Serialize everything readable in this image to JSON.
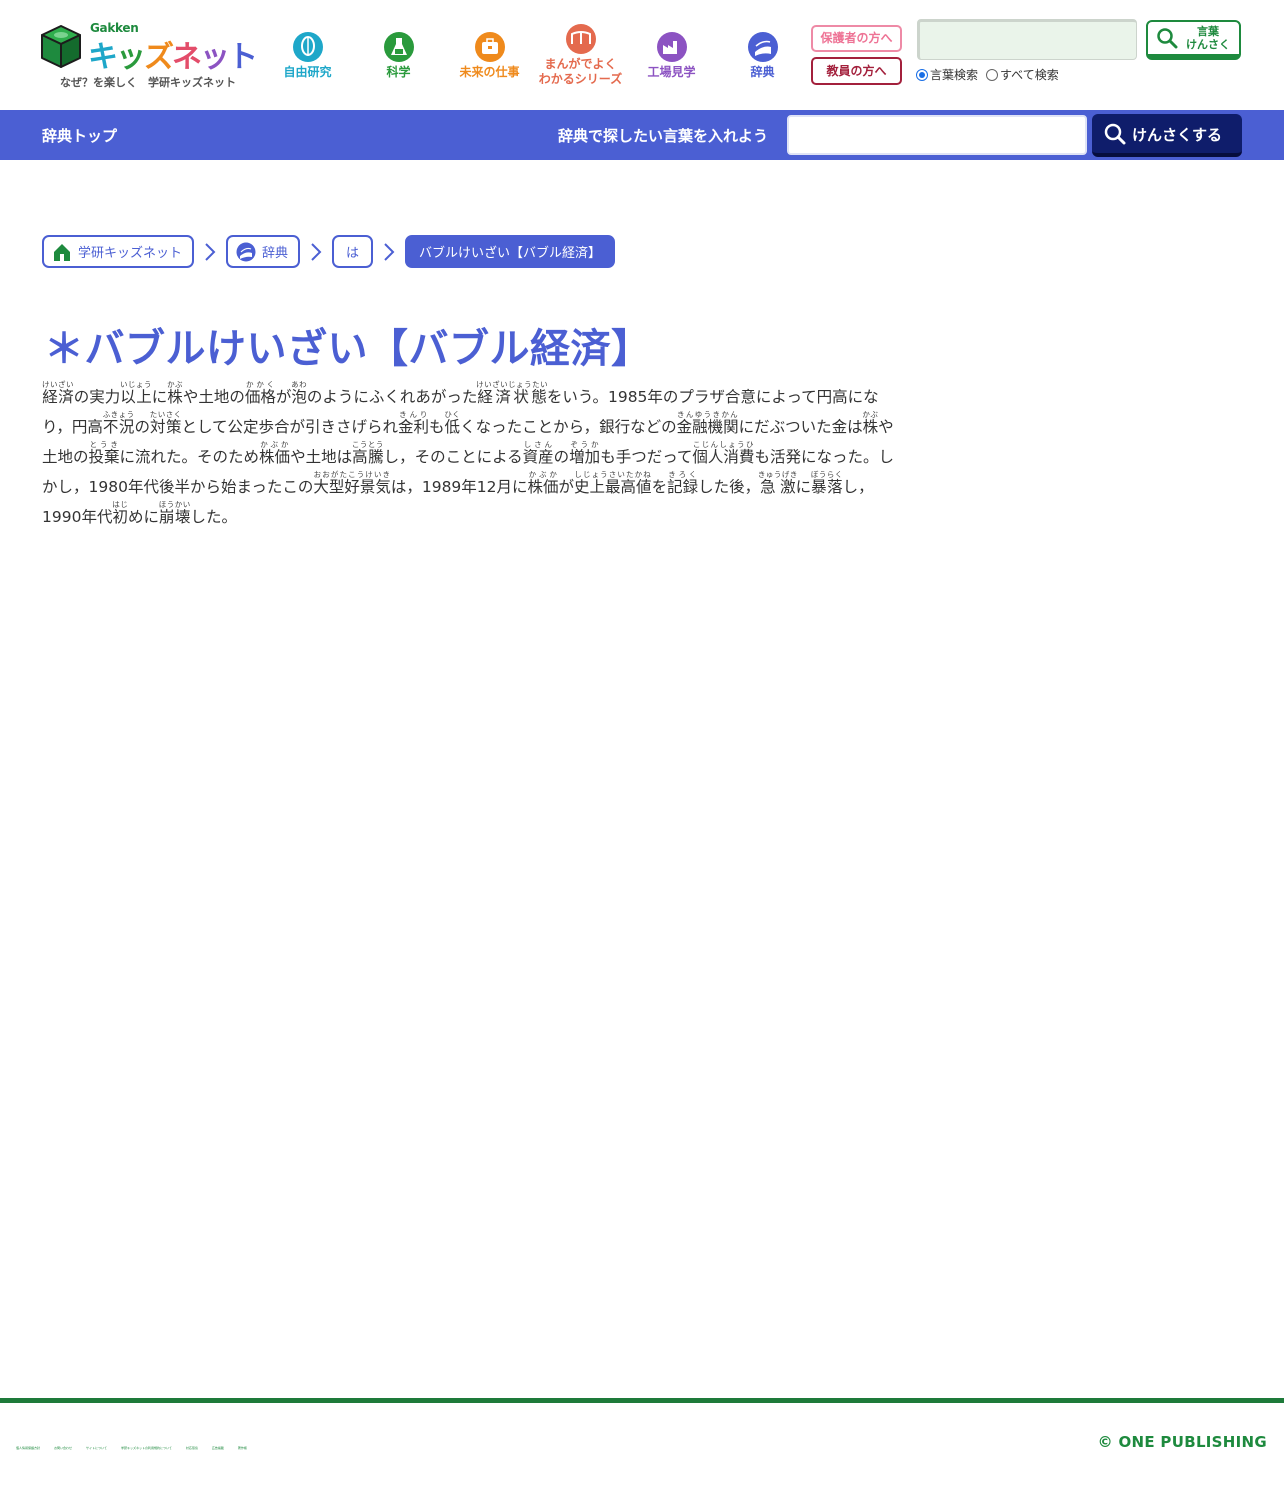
{
  "header": {
    "logo": {
      "brand": "Gakken",
      "name_parts": [
        "キ",
        "ッ",
        "ズ",
        "ネ",
        "ッ",
        "ト"
      ],
      "tagline": "なぜ？を楽しく　学研キッズネット"
    },
    "categories": [
      {
        "label": "自由研究",
        "color": "#1ea7c9",
        "icon": "lightbulb-icon"
      },
      {
        "label": "科学",
        "color": "#2a9a3c",
        "icon": "flask-icon"
      },
      {
        "label": "未来の仕事",
        "color": "#ef8a1c",
        "icon": "briefcase-icon"
      },
      {
        "label": "まんがでよく",
        "label2": "わかるシリーズ",
        "color": "#e46a4e",
        "icon": "manga-book-icon"
      },
      {
        "label": "工場見学",
        "color": "#8c53c2",
        "icon": "factory-icon"
      },
      {
        "label": "辞典",
        "color": "#4b5fd3",
        "icon": "dictionary-icon"
      }
    ],
    "parent_button": "保護者の方へ",
    "teacher_button": "教員の方へ",
    "search": {
      "placeholder": "",
      "button_line1": "言葉",
      "button_line2": "けんさく",
      "radio_word": "言葉検索",
      "radio_all": "すべて検索"
    },
    "colors": {
      "green": "#1e8a3e",
      "blue": "#4b5fd3"
    }
  },
  "dict_bar": {
    "top_link": "辞典トップ",
    "prompt": "辞典で探したい言葉を入れよう",
    "placeholder": "",
    "search_button": "けんさくする"
  },
  "breadcrumb": [
    {
      "label": "学研キッズネット",
      "icon": "home-icon"
    },
    {
      "label": "辞典",
      "icon": "dictionary-icon"
    },
    {
      "label": "は"
    },
    {
      "label": "バブルけいざい【バブル経済】"
    }
  ],
  "entry": {
    "title": "＊バブルけいざい【バブル経済】",
    "body": [
      {
        "r": "経済",
        "f": "けいざい"
      },
      {
        "t": "の実力"
      },
      {
        "r": "以上",
        "f": "いじょう"
      },
      {
        "t": "に"
      },
      {
        "r": "株",
        "f": "かぶ"
      },
      {
        "t": "や土地の"
      },
      {
        "r": "価格",
        "f": "かかく"
      },
      {
        "t": "が"
      },
      {
        "r": "泡",
        "f": "あわ"
      },
      {
        "t": "のようにふくれあがった"
      },
      {
        "r": "経済状態",
        "f": "けいざいじょうたい"
      },
      {
        "t": "をいう。1985年のプラザ合意によって円高になり，円高"
      },
      {
        "r": "不況",
        "f": "ふきょう"
      },
      {
        "t": "の"
      },
      {
        "r": "対策",
        "f": "たいさく"
      },
      {
        "t": "として公定歩合が引きさげられ"
      },
      {
        "r": "金利",
        "f": "きんり"
      },
      {
        "t": "も"
      },
      {
        "r": "低",
        "f": "ひく"
      },
      {
        "t": "くなったことから，銀行などの"
      },
      {
        "r": "金融機関",
        "f": "きんゆうきかん"
      },
      {
        "t": "にだぶついた金は"
      },
      {
        "r": "株",
        "f": "かぶ"
      },
      {
        "t": "や土地の"
      },
      {
        "r": "投棄",
        "f": "とうき"
      },
      {
        "t": "に流れた。そのため"
      },
      {
        "r": "株価",
        "f": "かぶか"
      },
      {
        "t": "や土地は"
      },
      {
        "r": "高騰",
        "f": "こうとう"
      },
      {
        "t": "し，そのことによる"
      },
      {
        "r": "資産",
        "f": "しさん"
      },
      {
        "t": "の"
      },
      {
        "r": "増加",
        "f": "ぞうか"
      },
      {
        "t": "も手つだって"
      },
      {
        "r": "個人消費",
        "f": "こじんしょうひ"
      },
      {
        "t": "も活発になった。しかし，1980年代後半から始まったこの"
      },
      {
        "r": "大型好景気",
        "f": "おおがたこうけいき"
      },
      {
        "t": "は，1989年12月に"
      },
      {
        "r": "株価",
        "f": "かぶか"
      },
      {
        "t": "が"
      },
      {
        "r": "史上最高値",
        "f": "しじょうさいたかね"
      },
      {
        "t": "を"
      },
      {
        "r": "記録",
        "f": "きろく"
      },
      {
        "t": "した後，"
      },
      {
        "r": "急激",
        "f": "きゅうげき"
      },
      {
        "t": "に"
      },
      {
        "r": "暴落",
        "f": "ぼうらく"
      },
      {
        "t": "し，1990年代"
      },
      {
        "r": "初",
        "f": "はじ"
      },
      {
        "t": "めに"
      },
      {
        "r": "崩壊",
        "f": "ほうかい"
      },
      {
        "t": "した。"
      }
    ]
  },
  "footer": {
    "links": [
      "個人情報保護方針",
      "お問い合わせ",
      "サイトについて",
      "学研キッズネットの利用規約について",
      "対応環境",
      "広告掲載",
      "著作権"
    ],
    "copyright": "© ONE PUBLISHING"
  }
}
